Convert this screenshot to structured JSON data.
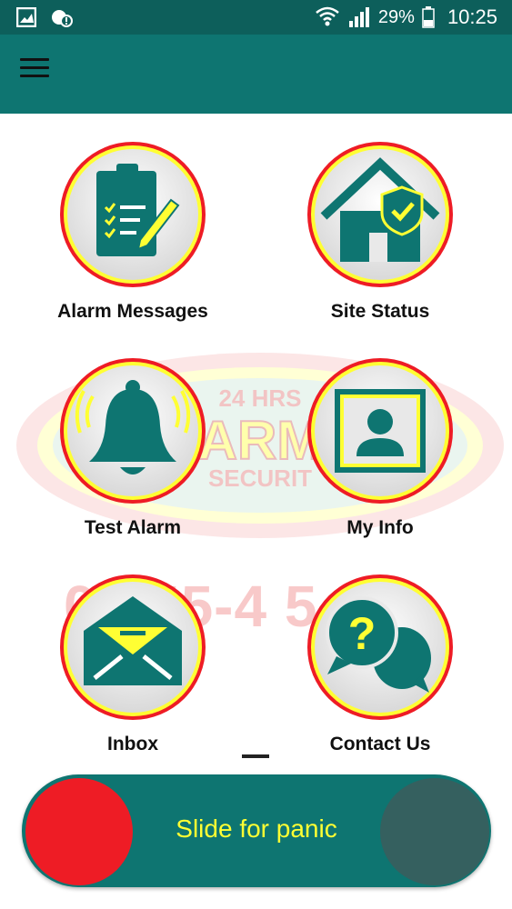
{
  "status_bar": {
    "battery": "29%",
    "time": "10:25"
  },
  "watermark": {
    "line1": "24 HRS",
    "line2": "ARM",
    "line3": "SECURIT",
    "phone": "0 855-4 5"
  },
  "tiles": [
    {
      "label": "Alarm Messages",
      "icon": "clipboard-checklist-icon"
    },
    {
      "label": "Site Status",
      "icon": "house-shield-icon"
    },
    {
      "label": "Test Alarm",
      "icon": "ringing-bell-icon"
    },
    {
      "label": "My Info",
      "icon": "user-profile-icon"
    },
    {
      "label": "Inbox",
      "icon": "envelope-icon"
    },
    {
      "label": "Contact Us",
      "icon": "question-chat-icon"
    }
  ],
  "panic": {
    "label": "Slide for panic"
  },
  "colors": {
    "teal": "#0e7571",
    "ring": "#ee1c25",
    "yellow": "#ffff33",
    "knob": "#ee1c25"
  }
}
